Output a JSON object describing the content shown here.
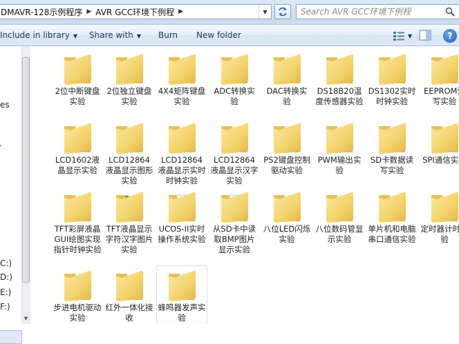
{
  "address": {
    "crumbs": [
      "DMAVR-128示例程序",
      "AVR GCC环境下例程"
    ]
  },
  "search": {
    "placeholder": "Search AVR GCC环境下例程"
  },
  "toolbar": {
    "include": "Include in library",
    "share": "Share with",
    "burn": "Burn",
    "newfolder": "New folder",
    "help": "?"
  },
  "nav": {
    "items": [
      "es",
      "C:)",
      "D:)",
      "E:)",
      "F:)"
    ]
  },
  "items": [
    {
      "label": "2位中断键盘实验"
    },
    {
      "label": "2位独立键盘实验"
    },
    {
      "label": "4X4矩阵键盘实验"
    },
    {
      "label": "ADC转换实验"
    },
    {
      "label": "DAC转换实验"
    },
    {
      "label": "DS18B20温度传感器实验"
    },
    {
      "label": "DS1302实时时钟实验"
    },
    {
      "label": "EEPROM读写实验"
    },
    {
      "label": "LCD1602液晶显示实验"
    },
    {
      "label": "LCD12864液晶显示图形实验"
    },
    {
      "label": "LCD12864液晶显示实时时钟实验"
    },
    {
      "label": "LCD12864液晶显示汉字实验"
    },
    {
      "label": "PS2键盘控制驱动实验"
    },
    {
      "label": "PWM输出实验"
    },
    {
      "label": "SD卡数据读写实验"
    },
    {
      "label": "SPI通信实验"
    },
    {
      "label": "TFT彩屏液晶GUI绘图实现指针时钟实验"
    },
    {
      "label": "TFT液晶显示字符汉字图片实验"
    },
    {
      "label": "UCOS-II实时操作系统实验"
    },
    {
      "label": "从SD卡中读取BMP图片显示实验"
    },
    {
      "label": "八位LED闪烁实验"
    },
    {
      "label": "八位数码管显示实验"
    },
    {
      "label": "单片机和电脑串口通信实验"
    },
    {
      "label": "定时器计时实验"
    },
    {
      "label": "步进电机驱动实验"
    },
    {
      "label": "红外一体化接收"
    },
    {
      "label": "蜂鸣器发声实验"
    }
  ],
  "colors": {
    "accent": "#1e395b",
    "folder": "#f3d36b"
  }
}
